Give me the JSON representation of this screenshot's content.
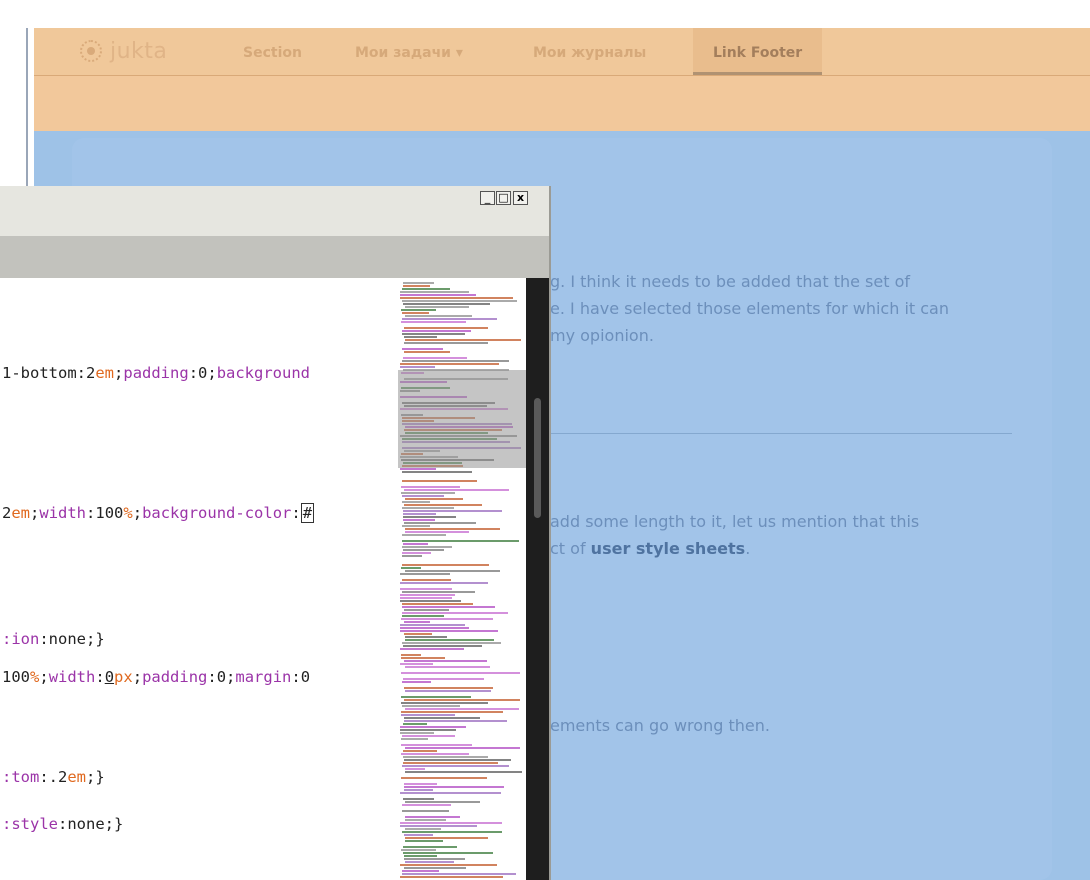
{
  "nav": {
    "logo_text": "jukta",
    "items": [
      "Section",
      "Мои задачи ▾",
      "Мои журналы"
    ],
    "active_item": "Link Footer"
  },
  "content": {
    "p1": [
      "g. I think it needs to be added that the set of",
      "e. I have selected those elements for which it can",
      "my opionion."
    ],
    "p2": [
      "add some length to it, let us mention that this",
      "ct of ",
      "user style sheets",
      "."
    ],
    "p3": "ements can go wrong then."
  },
  "window": {
    "buttons": {
      "minimize": "_",
      "maximize": "□",
      "close": "x"
    }
  },
  "code": {
    "line1": {
      "a": "1-bottom:",
      "b": "2",
      "c": "em",
      "d": ";",
      "e": "padding",
      "f": ":0;",
      "g": "background"
    },
    "line2": {
      "a": "2",
      "b": "em",
      "c": ";",
      "d": "width",
      "e": ":",
      "f": "100",
      "g": "%",
      "h": ";",
      "i": "background-color",
      "j": ":",
      "k": "#"
    },
    "line3": {
      "a": ":ion",
      "b": ":none;}"
    },
    "line4": {
      "a": "100",
      "b": "%",
      "c": ";",
      "d": "width",
      "e": ":",
      "f": "0",
      "g": "px",
      "h": ";",
      "i": "padding",
      "j": ":0;",
      "k": "margin",
      "l": ":0"
    },
    "line5": {
      "a": ":tom",
      "b": ":.2",
      "c": "em",
      "d": ";}"
    },
    "line6": {
      "a": ":style",
      "b": ":none;}"
    }
  },
  "colors": {
    "navbar": "#f0c89a",
    "page_bg": "#9ec2e7",
    "property": "#9b34a8",
    "unit": "#e0691f"
  }
}
